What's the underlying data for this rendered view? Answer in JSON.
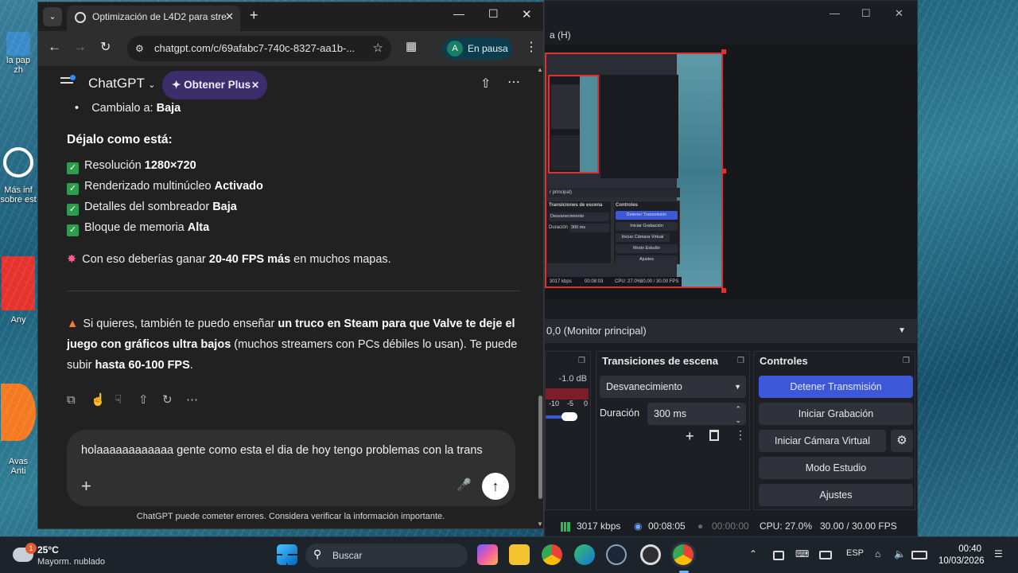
{
  "desktop": {
    "icons": [
      {
        "label": "la pap\nzh"
      },
      {
        "label": "Más inf\nsobre est"
      },
      {
        "label": "Any"
      },
      {
        "label": "Avas\nAnti"
      }
    ]
  },
  "obs": {
    "menu_partial": "a (H)",
    "preview": {
      "mini_monitor": "r principal)",
      "mini_transitions_title": "Transiciones de escena",
      "mini_controls_title": "Controles",
      "mini_fade": "Desvanecimiento",
      "mini_duration": "Duración",
      "mini_duration_val": "300 ms",
      "mini_stop": "Detener Transmisión",
      "mini_record": "Iniciar Grabación",
      "mini_vcam": "Iniciar Cámara Virtual",
      "mini_studio": "Modo Estudio",
      "mini_settings": "Ajustes",
      "mini_kbps": "3017 kbps",
      "mini_time": "00:08:03",
      "mini_cpu": "CPU: 27.0%",
      "mini_fps": "30.00 / 30.00 FPS"
    },
    "monitor_select": "0,0 (Monitor principal)",
    "mixer": {
      "db": "-1.0 dB",
      "ticks": [
        "-10",
        "-5",
        "0"
      ]
    },
    "transitions": {
      "title": "Transiciones de escena",
      "fade": "Desvanecimiento",
      "duration_label": "Duración",
      "duration_value": "300 ms"
    },
    "controls": {
      "title": "Controles",
      "stop_stream": "Detener Transmisión",
      "start_recording": "Iniciar Grabación",
      "start_vcam": "Iniciar Cámara Virtual",
      "studio_mode": "Modo Estudio",
      "settings": "Ajustes"
    },
    "status": {
      "kbps": "3017 kbps",
      "stream_time": "00:08:05",
      "rec_time": "00:00:00",
      "cpu": "CPU: 27.0%",
      "fps": "30.00 / 30.00 FPS"
    }
  },
  "chrome": {
    "tab_title": "Optimización de L4D2 para stre",
    "url": "chatgpt.com/c/69afabc7-740c-8327-aa1b-...",
    "profile_initial": "A",
    "profile_status": "En pausa"
  },
  "chatgpt": {
    "app_name": "ChatGPT",
    "get_plus": "Obtener Plus",
    "bullet_label": "Cambialo a: ",
    "bullet_value": "Baja",
    "section_title": "Déjalo como está:",
    "checklist": [
      {
        "label": "Resolución ",
        "value": "1280×720"
      },
      {
        "label": "Renderizado multinúcleo ",
        "value": "Activado"
      },
      {
        "label": "Detalles del sombreador ",
        "value": "Baja"
      },
      {
        "label": "Bloque de memoria ",
        "value": "Alta"
      }
    ],
    "gain_prefix": "Con eso deberías ganar ",
    "gain_bold": "20-40 FPS más",
    "gain_suffix": " en muchos mapas.",
    "tip_prefix": "Si quieres, también te puedo enseñar ",
    "tip_bold": "un truco en Steam para que Valve te deje el juego con gráficos ultra bajos",
    "tip_mid": " (muchos streamers con PCs débiles lo usan). Te puede subir ",
    "tip_bold2": "hasta 60-100 FPS",
    "tip_end": ".",
    "composer_text": "holaaaaaaaaaaaa gente como esta el dia de hoy tengo problemas con la trans",
    "disclaimer": "ChatGPT puede cometer errores. Considera verificar la información importante."
  },
  "taskbar": {
    "weather_temp": "25°C",
    "weather_desc": "Mayorm. nublado",
    "weather_badge": "1",
    "search_label": "Buscar",
    "lang": "ESP",
    "time": "00:40",
    "date": "10/03/2026"
  }
}
